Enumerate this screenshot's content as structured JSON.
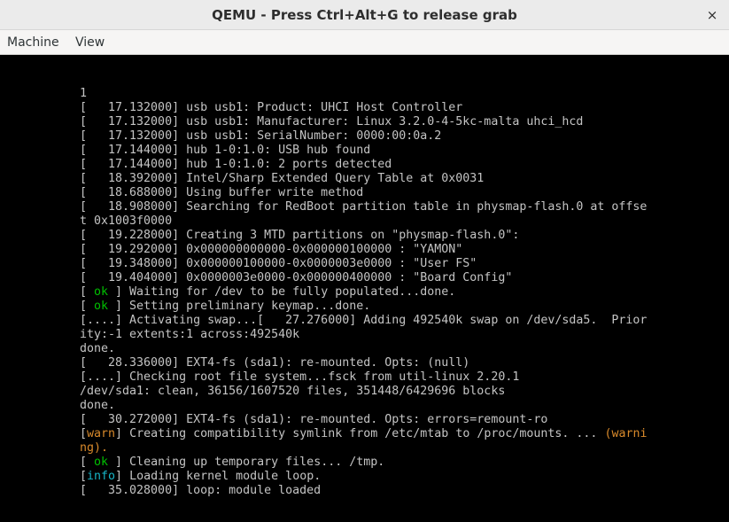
{
  "window": {
    "title": "QEMU - Press Ctrl+Alt+G to release grab",
    "close_glyph": "×"
  },
  "menubar": {
    "items": [
      "Machine",
      "View"
    ]
  },
  "colors": {
    "ok": "#00c000",
    "warn": "#d98a2b",
    "info": "#17b5c7",
    "console_text": "#c4c4c4",
    "background": "#000000"
  },
  "console": {
    "lines": [
      {
        "text": "1"
      },
      {
        "text": "[   17.132000] usb usb1: Product: UHCI Host Controller"
      },
      {
        "text": "[   17.132000] usb usb1: Manufacturer: Linux 3.2.0-4-5kc-malta uhci_hcd"
      },
      {
        "text": "[   17.132000] usb usb1: SerialNumber: 0000:00:0a.2"
      },
      {
        "text": "[   17.144000] hub 1-0:1.0: USB hub found"
      },
      {
        "text": "[   17.144000] hub 1-0:1.0: 2 ports detected"
      },
      {
        "text": "[   18.392000] Intel/Sharp Extended Query Table at 0x0031"
      },
      {
        "text": "[   18.688000] Using buffer write method"
      },
      {
        "text": "[   18.908000] Searching for RedBoot partition table in physmap-flash.0 at offse"
      },
      {
        "text": "t 0x1003f0000"
      },
      {
        "text": "[   19.228000] Creating 3 MTD partitions on \"physmap-flash.0\":"
      },
      {
        "text": "[   19.292000] 0x000000000000-0x000000100000 : \"YAMON\""
      },
      {
        "text": "[   19.348000] 0x000000100000-0x0000003e0000 : \"User FS\""
      },
      {
        "text": "[   19.404000] 0x0000003e0000-0x000000400000 : \"Board Config\""
      },
      {
        "open": "[ ",
        "tag": "ok",
        "close": " ]",
        "rest": " Waiting for /dev to be fully populated...done."
      },
      {
        "open": "[ ",
        "tag": "ok",
        "close": " ]",
        "rest": " Setting preliminary keymap...done."
      },
      {
        "text": "[....] Activating swap...[   27.276000] Adding 492540k swap on /dev/sda5.  Prior"
      },
      {
        "text": "ity:-1 extents:1 across:492540k"
      },
      {
        "text": "done."
      },
      {
        "text": "[   28.336000] EXT4-fs (sda1): re-mounted. Opts: (null)"
      },
      {
        "text": "[....] Checking root file system...fsck from util-linux 2.20.1"
      },
      {
        "text": "/dev/sda1: clean, 36156/1607520 files, 351448/6429696 blocks"
      },
      {
        "text": "done."
      },
      {
        "text": "[   30.272000] EXT4-fs (sda1): re-mounted. Opts: errors=remount-ro"
      },
      {
        "open": "[",
        "tag": "warn",
        "close": "]",
        "rest": " Creating compatibility symlink from /etc/mtab to /proc/mounts. ... ",
        "tail": "(warni"
      },
      {
        "tail_only": "ng)."
      },
      {
        "open": "[ ",
        "tag": "ok",
        "close": " ]",
        "rest": " Cleaning up temporary files... /tmp."
      },
      {
        "open": "[",
        "tag": "info",
        "close": "]",
        "rest": " Loading kernel module loop."
      },
      {
        "text": "[   35.028000] loop: module loaded"
      }
    ]
  }
}
